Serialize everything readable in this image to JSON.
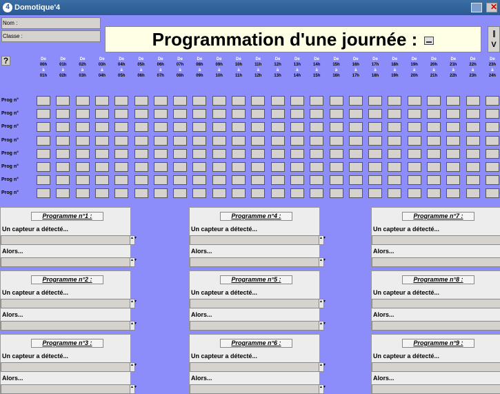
{
  "window": {
    "title": "Domotique'4",
    "icon": "app-logo-icon"
  },
  "header": {
    "nom_label": "Nom :",
    "classe_label": "Classe :",
    "help_label": "?",
    "title": "Programmation d'une journée :",
    "side_button_label": "V"
  },
  "schedule": {
    "from_prefix": "De",
    "to_prefix": "à",
    "start_hours": [
      "00h",
      "01h",
      "02h",
      "03h",
      "04h",
      "05h",
      "06h",
      "07h",
      "08h",
      "09h",
      "10h",
      "11h",
      "12h",
      "13h",
      "14h",
      "15h",
      "16h",
      "17h",
      "18h",
      "19h",
      "20h",
      "21h",
      "22h",
      "23h"
    ],
    "end_hours": [
      "01h",
      "02h",
      "03h",
      "04h",
      "05h",
      "06h",
      "07h",
      "08h",
      "09h",
      "10h",
      "11h",
      "12h",
      "13h",
      "14h",
      "15h",
      "16h",
      "17h",
      "18h",
      "19h",
      "20h",
      "21h",
      "22h",
      "23h",
      "24h"
    ],
    "row_labels": [
      "Prog n°",
      "Prog n°",
      "Prog n°",
      "Prog n°",
      "Prog n°",
      "Prog n°",
      "Prog n°",
      "Prog n°"
    ]
  },
  "programs": [
    {
      "title": "Programme n°1 :",
      "sensor_label": "Un capteur a détecté...",
      "then_label": "Alors..."
    },
    {
      "title": "Programme n°2 :",
      "sensor_label": "Un capteur a détecté...",
      "then_label": "Alors..."
    },
    {
      "title": "Programme n°3 :",
      "sensor_label": "Un capteur a détecté...",
      "then_label": "Alors..."
    },
    {
      "title": "Programme n°4 :",
      "sensor_label": "Un capteur a détecté...",
      "then_label": "Alors..."
    },
    {
      "title": "Programme n°5 :",
      "sensor_label": "Un capteur a détecté...",
      "then_label": "Alors..."
    },
    {
      "title": "Programme n°6 :",
      "sensor_label": "Un capteur a détecté...",
      "then_label": "Alors..."
    },
    {
      "title": "Programme n°7 :",
      "sensor_label": "Un capteur a détecté...",
      "then_label": "Alors..."
    },
    {
      "title": "Programme n°8 :",
      "sensor_label": "Un capteur a détecté...",
      "then_label": "Alors..."
    },
    {
      "title": "Programme n°9 :",
      "sensor_label": "Un capteur a détecté...",
      "then_label": "Alors..."
    }
  ],
  "colors": {
    "background": "#8c8cfb",
    "title_bar": "#2a5a92",
    "title_box": "#ffffe6"
  }
}
